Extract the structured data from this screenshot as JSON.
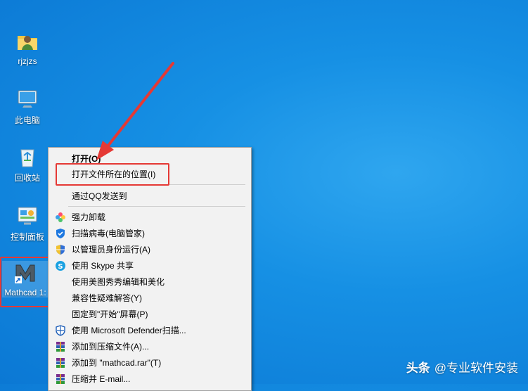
{
  "desktop": {
    "icons": [
      {
        "label": "rjzjzs"
      },
      {
        "label": "此电脑"
      },
      {
        "label": "回收站"
      },
      {
        "label": "控制面板"
      },
      {
        "label": "Mathcad 1:"
      }
    ]
  },
  "context_menu": {
    "items": [
      {
        "label": "打开(O)"
      },
      {
        "label": "打开文件所在的位置(I)"
      },
      {
        "label": "通过QQ发送到"
      },
      {
        "label": "强力卸载"
      },
      {
        "label": "扫描病毒(电脑管家)"
      },
      {
        "label": "以管理员身份运行(A)"
      },
      {
        "label": "使用 Skype 共享"
      },
      {
        "label": "使用美图秀秀编辑和美化"
      },
      {
        "label": "兼容性疑难解答(Y)"
      },
      {
        "label": "固定到\"开始\"屏幕(P)"
      },
      {
        "label": "使用 Microsoft Defender扫描..."
      },
      {
        "label": "添加到压缩文件(A)..."
      },
      {
        "label": "添加到 \"mathcad.rar\"(T)"
      },
      {
        "label": "压缩并 E-mail..."
      }
    ]
  },
  "watermark": {
    "brand": "头条",
    "handle": "@专业软件安装"
  },
  "colors": {
    "highlight": "#e53935",
    "desktop": "#1690e4"
  }
}
